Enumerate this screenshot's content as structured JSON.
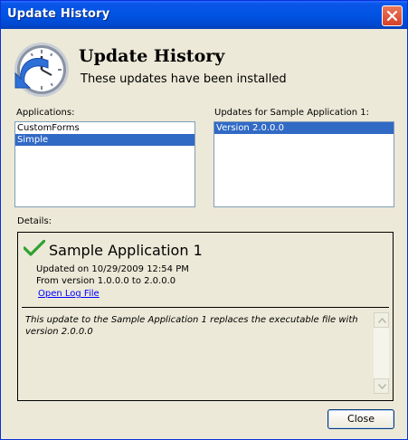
{
  "window": {
    "title": "Update History"
  },
  "header": {
    "title": "Update History",
    "subtitle": "These updates have been installed"
  },
  "applications": {
    "label": "Applications:",
    "items": [
      {
        "label": "CustomForms",
        "selected": false
      },
      {
        "label": "Simple",
        "selected": true
      }
    ]
  },
  "updates": {
    "label": "Updates for Sample Application 1:",
    "items": [
      {
        "label": "Version 2.0.0.0",
        "selected": true
      }
    ]
  },
  "details": {
    "label": "Details:",
    "app_name": "Sample Application 1",
    "updated_on": "Updated on 10/29/2009 12:54 PM",
    "version_change": "From version 1.0.0.0 to 2.0.0.0",
    "log_link": "Open Log File",
    "description": "This update to the Sample Application 1 replaces the executable file with version 2.0.0.0"
  },
  "footer": {
    "close_label": "Close"
  },
  "icons": {
    "logo": "clock-back-arrow-icon",
    "check": "checkmark-icon",
    "close": "close-icon"
  },
  "colors": {
    "titlebar": "#0053e3",
    "selection": "#316ac5",
    "link": "#0000ff",
    "check": "#2fa12f"
  }
}
